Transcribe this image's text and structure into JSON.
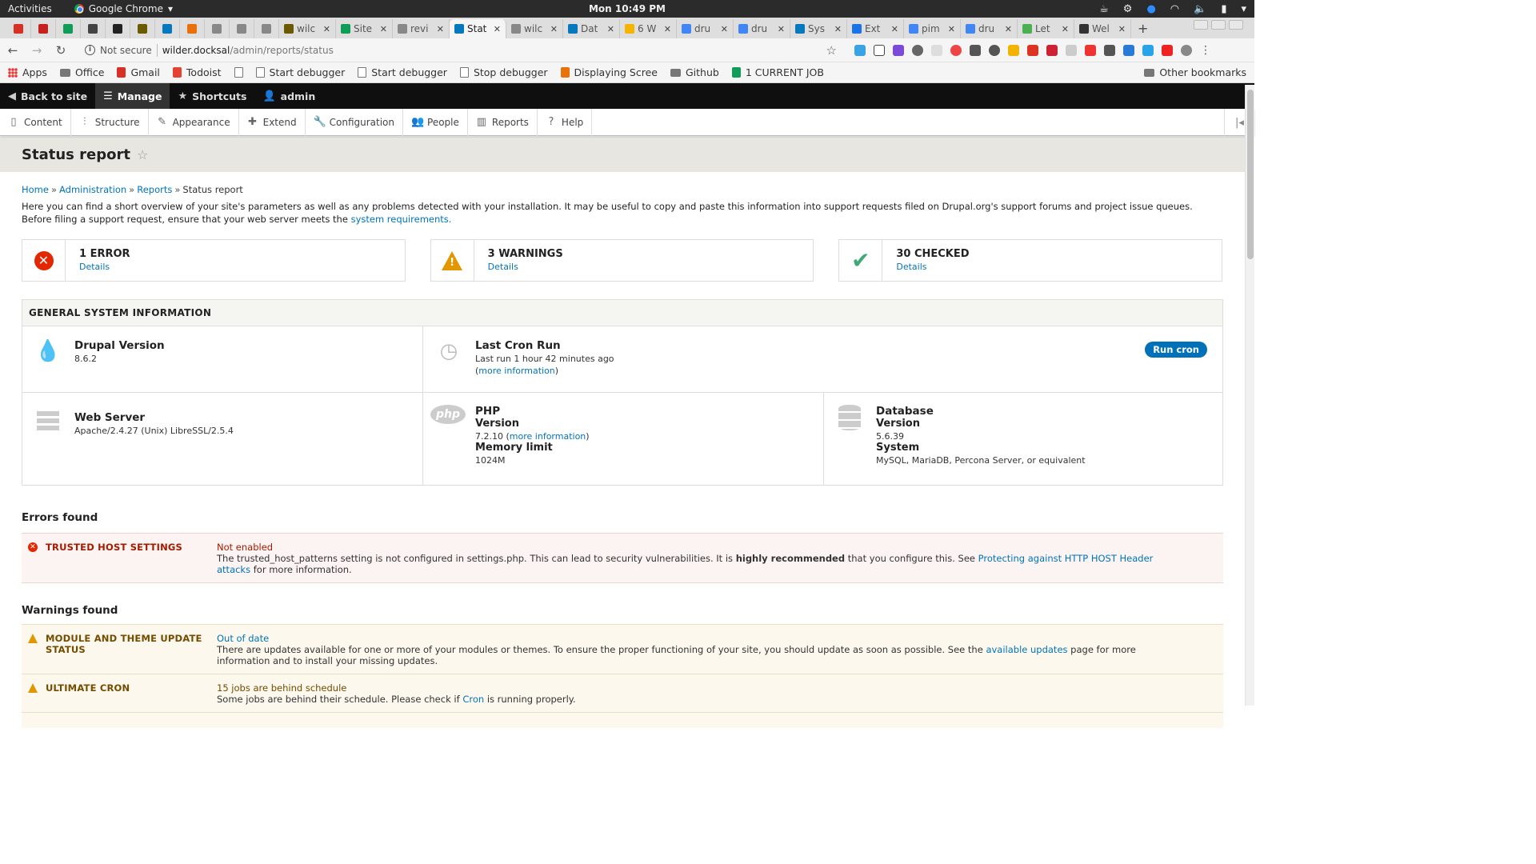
{
  "os_bar": {
    "activities": "Activities",
    "app_name": "Google Chrome",
    "clock": "Mon 10:49 PM"
  },
  "tabs": [
    {
      "title": "",
      "favicon_color": "#d93025",
      "kind": "pinned"
    },
    {
      "title": "",
      "favicon_color": "#c5221f",
      "kind": "pinned"
    },
    {
      "title": "",
      "favicon_color": "#0f9d58",
      "kind": "pinned"
    },
    {
      "title": "",
      "favicon_color": "#444444",
      "kind": "pinned"
    },
    {
      "title": "",
      "favicon_color": "#222222",
      "kind": "pinned"
    },
    {
      "title": "",
      "favicon_color": "#6b5a00",
      "kind": "pinned"
    },
    {
      "title": "",
      "favicon_color": "#0678be",
      "kind": "pinned"
    },
    {
      "title": "",
      "favicon_color": "#e8710a",
      "kind": "pinned"
    },
    {
      "title": "",
      "favicon_color": "#888888",
      "kind": "pinned"
    },
    {
      "title": "",
      "favicon_color": "#888888",
      "kind": "pinned"
    },
    {
      "title": "",
      "favicon_color": "#888888",
      "kind": "pinned"
    },
    {
      "title": "wilc",
      "favicon_color": "#6b5a00",
      "kind": "normal"
    },
    {
      "title": "Site",
      "favicon_color": "#0f9d58",
      "kind": "normal"
    },
    {
      "title": "revi",
      "favicon_color": "#888888",
      "kind": "normal"
    },
    {
      "title": "Stat",
      "favicon_color": "#0678be",
      "kind": "active"
    },
    {
      "title": "wilc",
      "favicon_color": "#888888",
      "kind": "normal"
    },
    {
      "title": "Dat",
      "favicon_color": "#0678be",
      "kind": "normal"
    },
    {
      "title": "6 W",
      "favicon_color": "#f4b400",
      "kind": "normal"
    },
    {
      "title": "dru",
      "favicon_color": "#4285f4",
      "kind": "normal"
    },
    {
      "title": "dru",
      "favicon_color": "#4285f4",
      "kind": "normal"
    },
    {
      "title": "Sys",
      "favicon_color": "#0678be",
      "kind": "normal"
    },
    {
      "title": "Ext",
      "favicon_color": "#1a73e8",
      "kind": "normal"
    },
    {
      "title": "pim",
      "favicon_color": "#4285f4",
      "kind": "normal"
    },
    {
      "title": "dru",
      "favicon_color": "#4285f4",
      "kind": "normal"
    },
    {
      "title": "Let",
      "favicon_color": "#4caf50",
      "kind": "normal"
    },
    {
      "title": "Wel",
      "favicon_color": "#333333",
      "kind": "normal"
    }
  ],
  "address_bar": {
    "security": "Not secure",
    "host": "wilder.docksal",
    "path": "/admin/reports/status"
  },
  "bookmarks": [
    {
      "label": "Apps",
      "icon": "apps-icon"
    },
    {
      "label": "Office",
      "icon": "folder-icon"
    },
    {
      "label": "Gmail",
      "icon": "gmail-icon"
    },
    {
      "label": "Todoist",
      "icon": "todoist-icon"
    },
    {
      "label": "",
      "icon": "page-icon"
    },
    {
      "label": "Start debugger",
      "icon": "page-icon"
    },
    {
      "label": "Start debugger",
      "icon": "page-icon"
    },
    {
      "label": "Stop debugger",
      "icon": "page-icon"
    },
    {
      "label": "Displaying Scree",
      "icon": "star-icon"
    },
    {
      "label": "Github",
      "icon": "folder-icon"
    },
    {
      "label": "1 CURRENT JOB",
      "icon": "drive-icon"
    }
  ],
  "other_bookmarks": "Other bookmarks",
  "drupal_toolbar": {
    "back": "Back to site",
    "manage": "Manage",
    "shortcuts": "Shortcuts",
    "user": "admin"
  },
  "admin_menu": [
    "Content",
    "Structure",
    "Appearance",
    "Extend",
    "Configuration",
    "People",
    "Reports",
    "Help"
  ],
  "page": {
    "title": "Status report",
    "breadcrumb": [
      "Home",
      "Administration",
      "Reports"
    ],
    "breadcrumb_current": "Status report",
    "intro": "Here you can find a short overview of your site's parameters as well as any problems detected with your installation. It may be useful to copy and paste this information into support requests filed on Drupal.org's support forums and project issue queues. Before filing a support request, ensure that your web server meets the",
    "intro_link": "system requirements."
  },
  "summary": {
    "errors": "1 ERROR",
    "warnings": "3 WARNINGS",
    "checked": "30 CHECKED",
    "details": "Details"
  },
  "general_info": {
    "heading": "GENERAL SYSTEM INFORMATION",
    "drupal_title": "Drupal Version",
    "drupal_version": "8.6.2",
    "cron_title": "Last Cron Run",
    "cron_last": "Last run 1 hour 42 minutes ago",
    "cron_more": "more information",
    "run_cron": "Run cron",
    "web_title": "Web Server",
    "web_value": "Apache/2.4.27 (Unix) LibreSSL/2.5.4",
    "php_logo": "php",
    "php_title": "PHP",
    "php_version_label": "Version",
    "php_version": "7.2.10",
    "php_more": "more information",
    "php_mem_label": "Memory limit",
    "php_mem": "1024M",
    "db_title": "Database",
    "db_version_label": "Version",
    "db_version": "5.6.39",
    "db_system_label": "System",
    "db_system": "MySQL, MariaDB, Percona Server, or equivalent"
  },
  "errors_found": {
    "heading": "Errors found",
    "items": [
      {
        "label": "TRUSTED HOST SETTINGS",
        "status": "Not enabled",
        "text_before": "The trusted_host_patterns setting is not configured in settings.php. This can lead to security vulnerabilities. It is",
        "bold": "highly recommended",
        "text_mid": "that you configure this. See",
        "link": "Protecting against HTTP HOST Header attacks",
        "text_after": "for more information."
      }
    ]
  },
  "warnings_found": {
    "heading": "Warnings found",
    "items": [
      {
        "label_line1": "MODULE AND THEME UPDATE",
        "label_line2": "STATUS",
        "status": "Out of date",
        "text_before": "There are updates available for one or more of your modules or themes. To ensure the proper functioning of your site, you should update as soon as possible. See the",
        "link": "available updates",
        "text_after": "page for more information and to install your missing updates."
      },
      {
        "label": "ULTIMATE CRON",
        "status": "15 jobs are behind schedule",
        "text_before": "Some jobs are behind their schedule. Please check if",
        "link": "Cron",
        "text_after": "is running properly."
      }
    ]
  },
  "colors": {
    "drupal_blue": "#0678be",
    "error_red": "#e32700",
    "warning_orange": "#e29700",
    "ok_green": "#42a877"
  }
}
